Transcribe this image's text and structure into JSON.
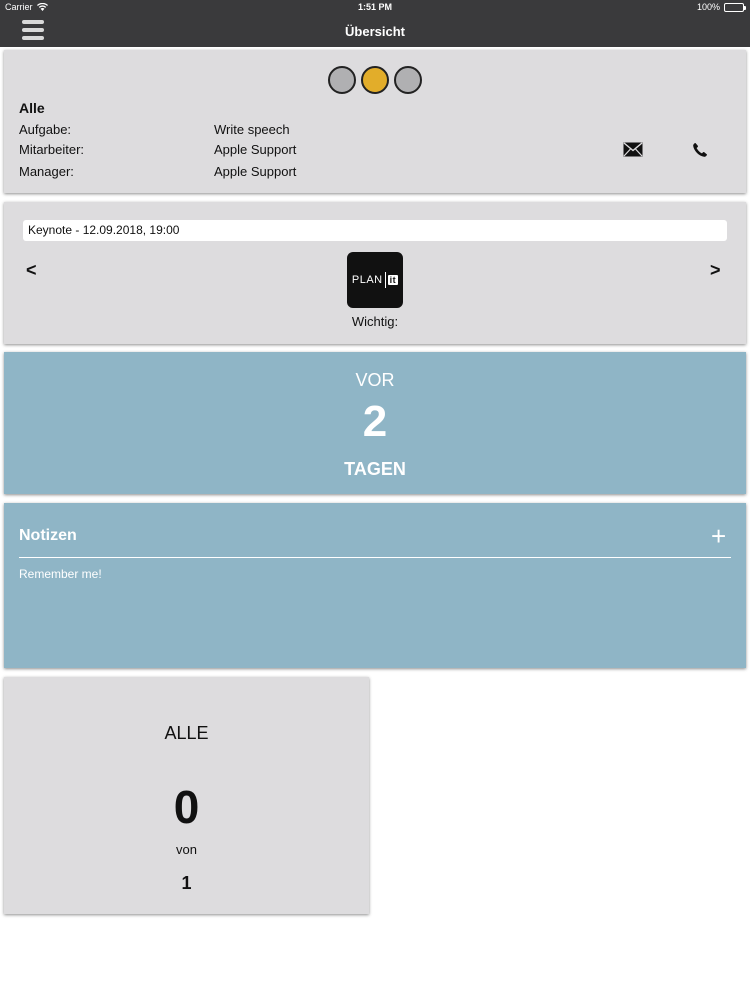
{
  "status_bar": {
    "carrier": "Carrier",
    "time": "1:51 PM",
    "battery": "100%"
  },
  "nav": {
    "title": "Übersicht",
    "menu_icon": "hamburger-menu-icon"
  },
  "summary": {
    "status_dots": 3,
    "active_dot": 1,
    "active_color": "#e2ad2a",
    "filter_title": "Alle",
    "rows": [
      {
        "label": "Aufgabe:",
        "value": "Write speech"
      },
      {
        "label": "Mitarbeiter:",
        "value": "Apple Support"
      },
      {
        "label": "Manager:",
        "value": "Apple Support"
      }
    ],
    "mail_icon": "mail-icon",
    "phone_icon": "phone-icon"
  },
  "event": {
    "title": "Keynote - 12.09.2018, 19:00",
    "prev": "<",
    "next": ">",
    "logo_text": "PLAN",
    "logo_badge": "it",
    "importance_label": "Wichtig:"
  },
  "countdown": {
    "prefix": "VOR",
    "value": "2",
    "unit": "TAGEN",
    "color": "#8fb5c6"
  },
  "notes": {
    "title": "Notizen",
    "add": "+",
    "text": "Remember me!"
  },
  "tasks": {
    "label": "ALLE",
    "done": "0",
    "of": "von",
    "total": "1"
  }
}
